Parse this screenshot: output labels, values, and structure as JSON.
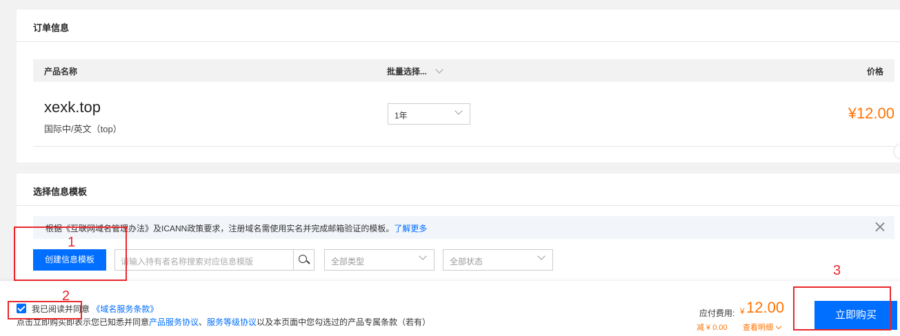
{
  "order": {
    "title": "订单信息",
    "columns": {
      "product_name": "产品名称",
      "batch_select": "批量选择...",
      "price": "价格"
    },
    "item": {
      "domain": "xexk.top",
      "type": "国际中/英文（top）",
      "period": "1年",
      "price": "¥12.00"
    }
  },
  "template": {
    "title": "选择信息模板",
    "notice_text": "根据《互联网域名管理办法》及ICANN政策要求，注册域名需使用实名并完成邮箱验证的模板。",
    "notice_link": "了解更多",
    "create_button": "创建信息模板",
    "search_placeholder": "请输入持有者名称搜索对应信息模版",
    "type_filter": "全部类型",
    "status_filter": "全部状态"
  },
  "footer": {
    "agree_text": "我已阅读并同意",
    "agree_link": "《域名服务条款》",
    "note_prefix": "点击立即购买即表示您已知悉并同意",
    "note_link1": "产品服务协议",
    "note_sep": "、",
    "note_link2": "服务等级协议",
    "note_suffix": "以及本页面中您勾选过的产品专属条款（若有）",
    "fee_label": "应付费用:",
    "fee_currency": "¥",
    "fee_amount": "12.00",
    "discount": "减 ¥ 0.00",
    "details": "查看明细",
    "buy_button": "立即购买"
  },
  "annotations": {
    "n1": "1",
    "n2": "2",
    "n3": "3"
  },
  "colors": {
    "accent": "#006eff",
    "price": "#ff7200",
    "annotation": "#e8262a"
  }
}
